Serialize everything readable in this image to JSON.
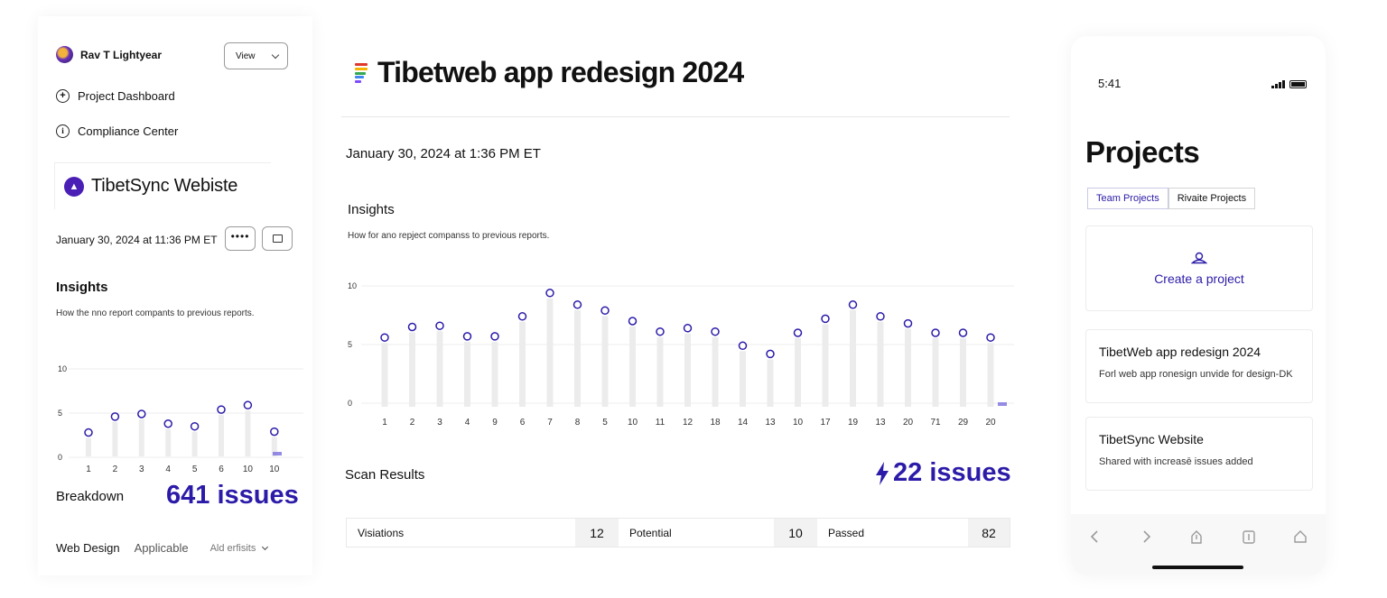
{
  "left_panel": {
    "user_name": "Rav T Lightyear",
    "view_label": "View",
    "nav": [
      {
        "label": "Project Dashboard",
        "icon": "plus-circle-icon"
      },
      {
        "label": "Compliance Center",
        "icon": "info-circle-icon"
      }
    ],
    "project_title": "TibetSync Webiste",
    "date": "January 30, 2024 at 11:36 PM ET",
    "more_label": "••••",
    "insights_title": "Insights",
    "insights_sub": "How the nno report compants to previous reports.",
    "breakdown_label": "Breakdown",
    "breakdown_value": "641 issues",
    "tabs": [
      "Web Design",
      "Applicable",
      "Ald erfisits"
    ]
  },
  "center_panel": {
    "title": "Tibetweb app redesign 2024",
    "logo_colors": [
      "#e0392b",
      "#f4b400",
      "#34a853",
      "#4285f4",
      "#7c4dff"
    ],
    "date": "January 30, 2024 at 1:36 PM ET",
    "insights_title": "Insights",
    "insights_sub": "How for ano repject companss to previous reports.",
    "scan_label": "Scan Results",
    "scan_value": "22 issues",
    "results": [
      {
        "label": "Visiations",
        "value": "12"
      },
      {
        "label": "Potential",
        "value": "10"
      },
      {
        "label": "Passed",
        "value": "82"
      }
    ]
  },
  "phone": {
    "time": "5:41",
    "heading": "Projects",
    "tabs": [
      "Team Projects",
      "Rivaite Projects"
    ],
    "create_label": "Create a project",
    "cards": [
      {
        "title": "TibetWeb app redesign 2024",
        "desc": "Forl web app ronesign unvide for design-DK"
      },
      {
        "title": "TibetSync Website",
        "desc": "Shared with increasē issues added"
      }
    ]
  },
  "colors": {
    "accent": "#2b1ba8",
    "bar": "#ececec",
    "marker": "#2b1ba8"
  },
  "chart_data": [
    {
      "type": "bar",
      "categories": [
        "1",
        "2",
        "3",
        "4",
        "5",
        "6",
        "10",
        "10"
      ],
      "values": [
        2.8,
        4.6,
        4.9,
        3.8,
        3.5,
        5.4,
        5.9,
        2.9
      ],
      "yticks": [
        "0",
        "5",
        "10"
      ],
      "ylim": [
        0,
        10
      ]
    },
    {
      "type": "bar",
      "categories": [
        "1",
        "2",
        "3",
        "4",
        "9",
        "6",
        "7",
        "8",
        "5",
        "10",
        "11",
        "12",
        "18",
        "14",
        "13",
        "10",
        "17",
        "19",
        "13",
        "20",
        "71",
        "29",
        "20"
      ],
      "values": [
        5.6,
        6.5,
        6.6,
        5.7,
        5.7,
        7.4,
        9.4,
        8.4,
        7.9,
        7.0,
        6.1,
        6.4,
        6.1,
        4.9,
        4.2,
        6.0,
        7.2,
        8.4,
        7.4,
        6.8,
        6.0,
        6.0,
        5.6
      ],
      "yticks": [
        "0",
        "5",
        "10"
      ],
      "ylim": [
        -3,
        10
      ]
    }
  ]
}
